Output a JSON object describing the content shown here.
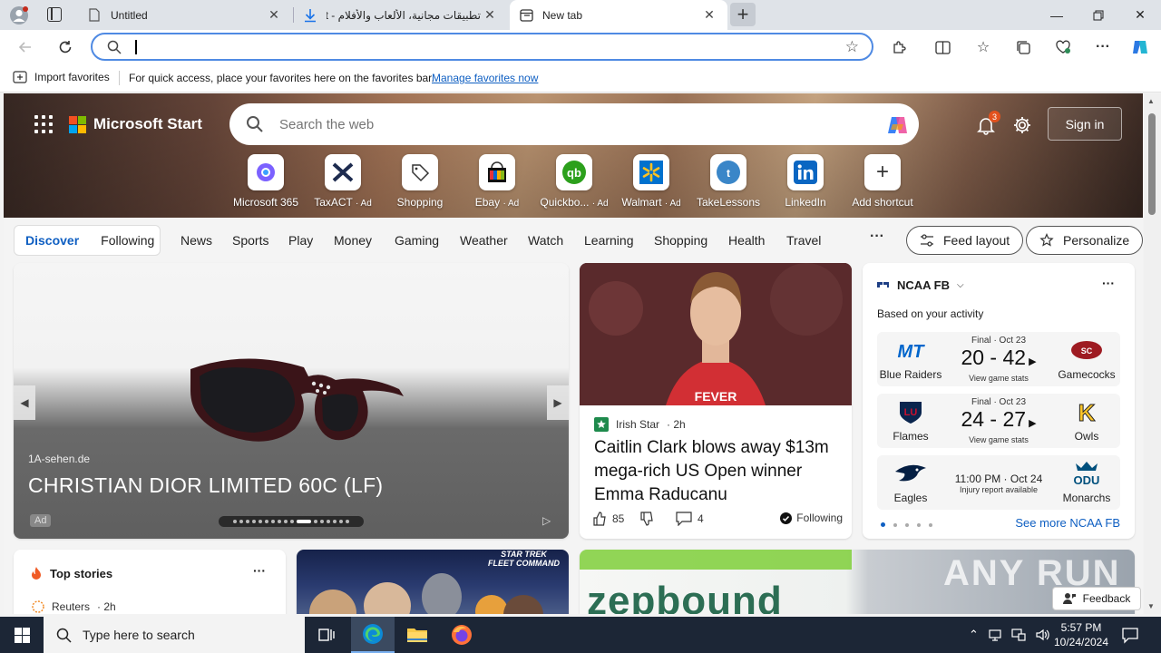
{
  "browser": {
    "tabs": [
      {
        "title": "Untitled",
        "icon": "page-icon"
      },
      {
        "title": "تطبيقات مجانية، الألعاب والأفلام - it",
        "icon": "download-icon"
      },
      {
        "title": "New tab",
        "icon": "newtab-icon",
        "active": true
      }
    ],
    "address_placeholder": "",
    "favorites_bar": {
      "import_label": "Import favorites",
      "message": "For quick access, place your favorites here on the favorites bar.",
      "manage_link": "Manage favorites now"
    }
  },
  "msn": {
    "brand": "Microsoft Start",
    "search_placeholder": "Search the web",
    "notification_count": "3",
    "signin_label": "Sign in",
    "shortcuts": [
      {
        "label": "Microsoft 365",
        "ad": ""
      },
      {
        "label": "TaxACT",
        "ad": "· Ad"
      },
      {
        "label": "Shopping",
        "ad": ""
      },
      {
        "label": "Ebay",
        "ad": "· Ad"
      },
      {
        "label": "Quickbo...",
        "ad": "· Ad"
      },
      {
        "label": "Walmart",
        "ad": "· Ad"
      },
      {
        "label": "TakeLessons",
        "ad": ""
      },
      {
        "label": "LinkedIn",
        "ad": ""
      },
      {
        "label": "Add shortcut",
        "ad": ""
      }
    ],
    "nav": {
      "discover": "Discover",
      "following": "Following",
      "items": [
        "News",
        "Sports",
        "Play",
        "Money",
        "Gaming",
        "Weather",
        "Watch",
        "Learning",
        "Shopping",
        "Health",
        "Travel"
      ],
      "more": "···",
      "feed_layout": "Feed layout",
      "personalize": "Personalize"
    },
    "ad_card": {
      "source": "1A-sehen.de",
      "title": "CHRISTIAN DIOR LIMITED 60C (LF)",
      "badge": "Ad"
    },
    "news_card": {
      "source": "Irish Star",
      "age": "· 2h",
      "title": "Caitlin Clark blows away $13m mega-rich US Open winner Emma Raducanu",
      "likes": "85",
      "comments": "4",
      "following": "Following"
    },
    "ncaa": {
      "title": "NCAA FB",
      "subtitle": "Based on your activity",
      "games": [
        {
          "status": "Final · Oct 23",
          "score": "20 - 42",
          "stats": "View game stats",
          "home": "Blue Raiders",
          "away": "Gamecocks"
        },
        {
          "status": "Final · Oct 23",
          "score": "24 - 27",
          "stats": "View game stats",
          "home": "Flames",
          "away": "Owls"
        },
        {
          "time": "11:00 PM · Oct 24",
          "stats": "Injury report available",
          "home": "Eagles",
          "away": "Monarchs"
        }
      ],
      "see_more": "See more NCAA FB"
    },
    "top_stories": {
      "title": "Top stories",
      "source": "Reuters",
      "age": "· 2h"
    },
    "star_trek_logo": "STAR TREK\nFLEET COMMAND",
    "zepbound_text": "zepbound",
    "feedback": "Feedback",
    "watermark": "ANY RUN"
  },
  "taskbar": {
    "search_placeholder": "Type here to search",
    "time": "5:57 PM",
    "date": "10/24/2024"
  },
  "colors": {
    "accent": "#0f5fc2",
    "taskbar": "#1c2636",
    "address_border": "#4f8ae3"
  }
}
